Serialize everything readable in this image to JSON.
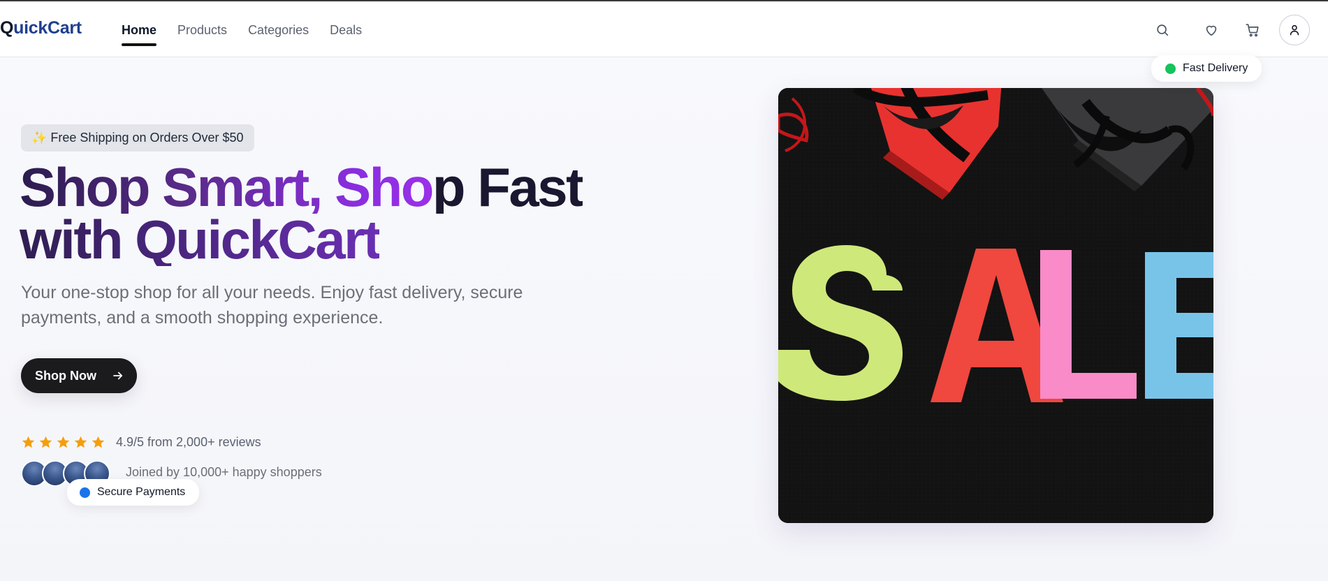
{
  "brand": {
    "name_part1": "Q",
    "name_part2": "uickCart"
  },
  "nav": {
    "links": [
      {
        "label": "Home",
        "active": true
      },
      {
        "label": "Products",
        "active": false
      },
      {
        "label": "Categories",
        "active": false
      },
      {
        "label": "Deals",
        "active": false
      }
    ],
    "icons": [
      "search-icon",
      "heart-icon",
      "cart-icon",
      "user-icon"
    ]
  },
  "hero": {
    "badge": "✨ Free Shipping on Orders Over $50",
    "headline_line1": "Shop Smart, Shop Fast",
    "headline_line2": "with QuickCart",
    "subtext": "Your one-stop shop for all your needs. Enjoy fast delivery, secure payments, and a smooth shopping experience.",
    "cta_label": "Shop Now",
    "rating": {
      "stars": 5,
      "text": "4.9/5 from 2,000+ reviews"
    },
    "joined_text": "Joined by 10,000+ happy shoppers",
    "avatar_count": 4
  },
  "floating": {
    "secure_payments": {
      "label": "Secure Payments",
      "dot_color": "#1a73e8"
    },
    "fast_delivery": {
      "label": "Fast Delivery",
      "dot_color": "#16c35c"
    }
  },
  "image": {
    "sale_text": "SALE"
  },
  "colors": {
    "star": "#f59e0b",
    "button_bg": "#1b1b1d",
    "headline_purple": "#9a30e8",
    "logo_blue": "#1f3f8f"
  }
}
